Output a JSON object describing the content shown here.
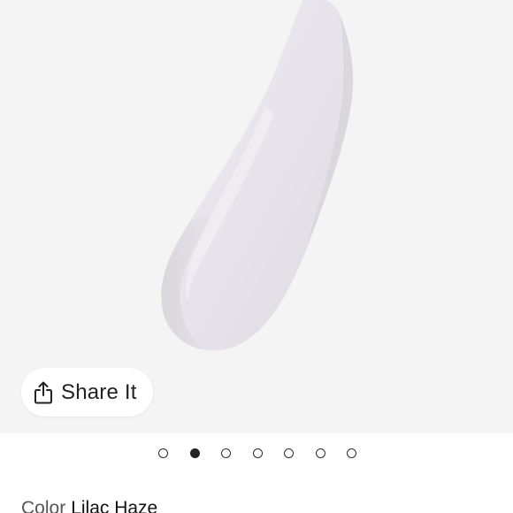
{
  "share": {
    "label": "Share It",
    "icon": "share-icon"
  },
  "carousel": {
    "total": 7,
    "active_index": 1
  },
  "product": {
    "color_label": "Color",
    "color_value": "Lilac Haze"
  },
  "colors": {
    "background": "#f4f4f4",
    "swatch": "#e7e4ec",
    "text": "#222222"
  }
}
